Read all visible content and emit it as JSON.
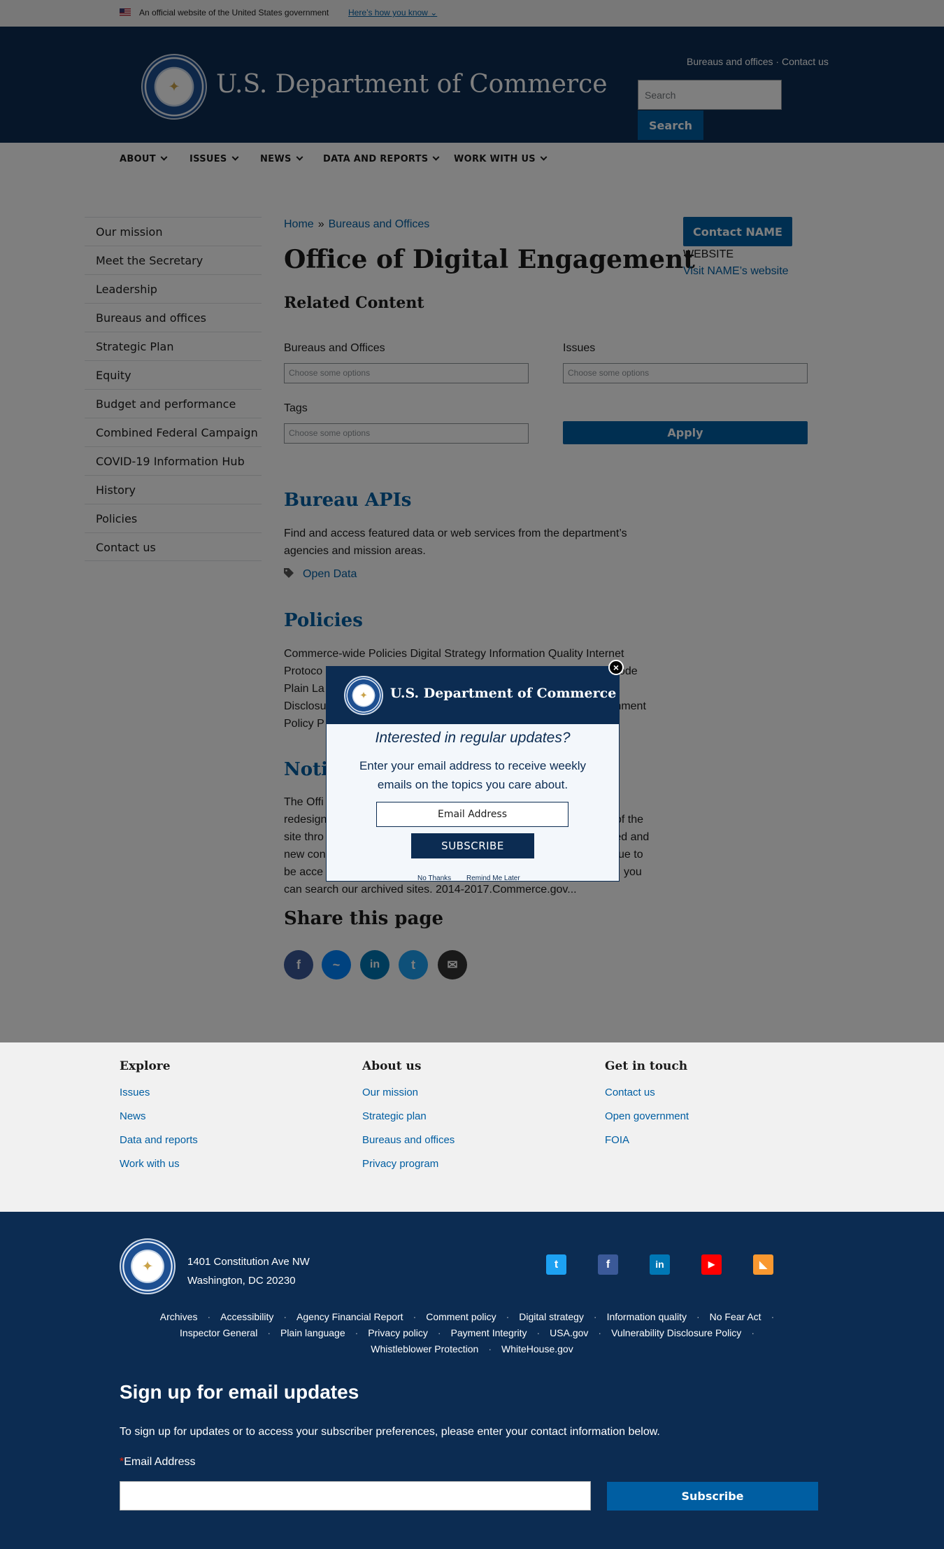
{
  "gov_banner": {
    "text": "An official website of the United States government",
    "how_link": "Here’s how you know"
  },
  "header": {
    "title": "U.S. Department of Commerce",
    "util_links": [
      "Bureaus and offices",
      "Contact us"
    ],
    "search_placeholder": "Search",
    "search_button": "Search"
  },
  "nav": {
    "items": [
      "ABOUT",
      "ISSUES",
      "NEWS",
      "DATA AND REPORTS",
      "WORK WITH US"
    ]
  },
  "sidebar": {
    "items": [
      "Our mission",
      "Meet the Secretary",
      "Leadership",
      "Bureaus and offices",
      "Strategic Plan",
      "Equity",
      "Budget and performance",
      "Combined Federal Campaign",
      "COVID-19 Information Hub",
      "History",
      "Policies",
      "Contact us"
    ]
  },
  "breadcrumb": {
    "home": "Home",
    "separator": "»",
    "current": "Bureaus and Offices"
  },
  "main": {
    "title": "Office of Digital Engagement",
    "related_heading": "Related Content",
    "filters": {
      "bureaus_label": "Bureaus and Offices",
      "issues_label": "Issues",
      "tags_label": "Tags",
      "placeholder": "Choose some options",
      "apply": "Apply"
    },
    "contact": {
      "button": "Contact NAME",
      "website_label": "WEBSITE",
      "website_link": "Visit NAME’s website"
    },
    "bureau_apis": {
      "heading": "Bureau APIs",
      "text": "Find and access featured data or web services from the department’s agencies and mission areas.",
      "tag": "Open Data"
    },
    "policies": {
      "heading": "Policies",
      "line1": "Commerce-wide Policies Digital Strategy Information Quality Internet",
      "line2_left": "Protoco",
      "line2_right": "ode",
      "line3_left": "Plain La",
      "line4_left": "Disclosu",
      "line4_right": "mment",
      "line5_left": "Policy P"
    },
    "notice": {
      "heading_partial": "Notic",
      "lines_left": [
        "The Offi",
        "redesign",
        "site thro",
        "new con",
        "be acce"
      ],
      "lines_right": [
        "",
        "of the",
        "red and",
        "ue to",
        "you"
      ],
      "last_line": "can search our archived sites. 2014-2017.Commerce.gov..."
    },
    "share_heading": "Share this page"
  },
  "footer_top": {
    "explore": {
      "heading": "Explore",
      "links": [
        "Issues",
        "News",
        "Data and reports",
        "Work with us"
      ]
    },
    "about": {
      "heading": "About us",
      "links": [
        "Our mission",
        "Strategic plan",
        "Bureaus and offices",
        "Privacy program"
      ]
    },
    "contact": {
      "heading": "Get in touch",
      "links": [
        "Contact us",
        "Open government",
        "FOIA"
      ]
    }
  },
  "footer_bottom": {
    "address_line1": "1401 Constitution Ave NW",
    "address_line2": "Washington, DC 20230",
    "links_row1": [
      "Archives",
      "Accessibility",
      "Agency Financial Report",
      "Comment policy",
      "Digital strategy",
      "Information quality",
      "No Fear Act"
    ],
    "links_row2": [
      "Inspector General",
      "Plain language",
      "Privacy policy",
      "Payment Integrity",
      "USA.gov",
      "Vulnerability Disclosure Policy"
    ],
    "links_row3": [
      "Whistleblower Protection",
      "WhiteHouse.gov"
    ],
    "signup_heading": "Sign up for email updates",
    "signup_text": "To sign up for updates or to access your subscriber preferences, please enter your contact information below.",
    "email_label": "Email Address",
    "required_mark": "*",
    "subscribe": "Subscribe"
  },
  "modal": {
    "title": "U.S. Department of Commerce",
    "question": "Interested in regular updates?",
    "description": "Enter your email address to receive weekly emails on the topics you care about.",
    "email_placeholder": "Email Address",
    "subscribe": "SUBSCRIBE",
    "no_thanks": "No Thanks",
    "remind_later": "Remind Me Later",
    "close": "×"
  },
  "colors": {
    "navy": "#0c2c52",
    "link": "#005ea2",
    "facebook": "#3b5998",
    "messenger": "#0084ff",
    "linkedin": "#0077b5",
    "twitter": "#1da1f2",
    "email": "#333333",
    "youtube": "#ff0000",
    "rss": "#f99830"
  }
}
